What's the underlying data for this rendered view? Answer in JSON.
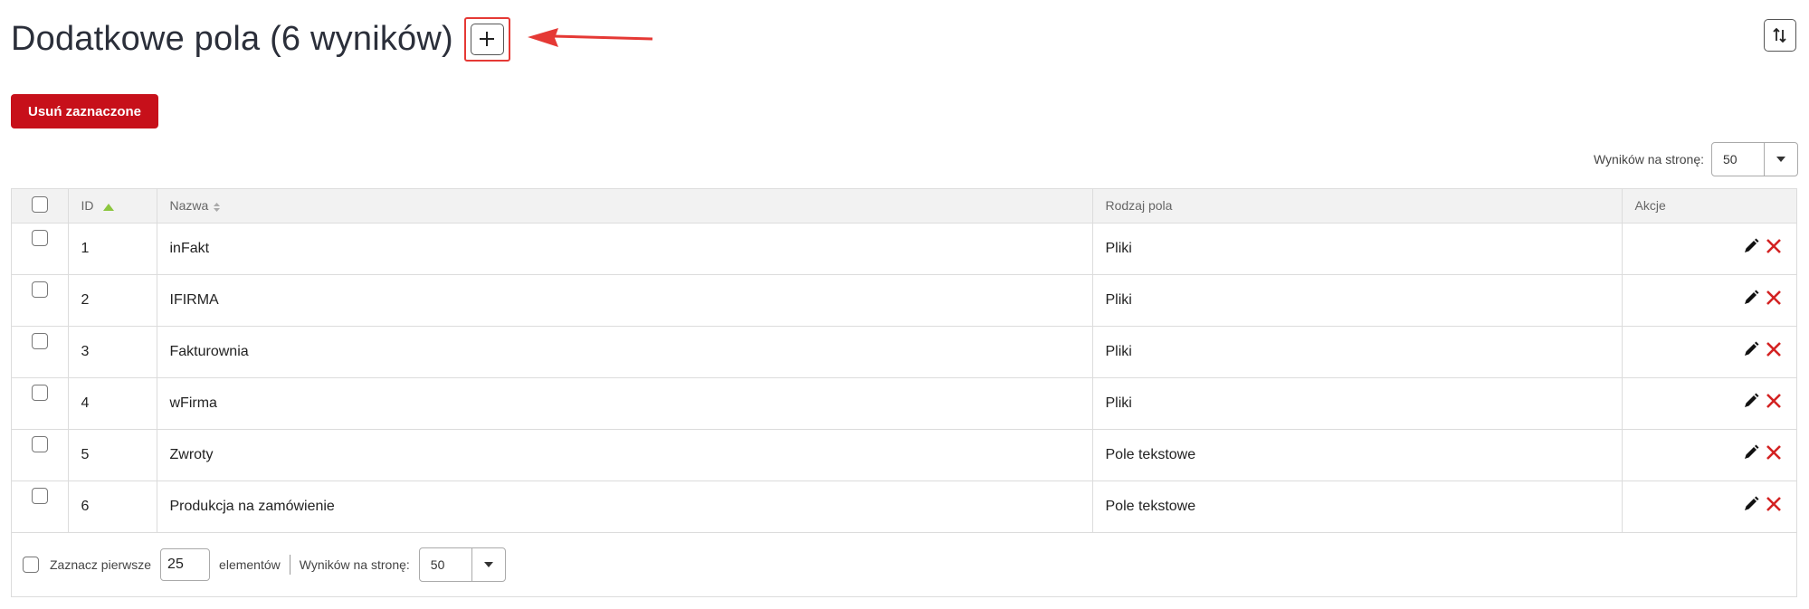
{
  "header": {
    "title": "Dodatkowe pola (6 wyników)",
    "add_label": "+"
  },
  "toolbar": {
    "delete_selected_label": "Usuń zaznaczone"
  },
  "pagination_top": {
    "per_page_label": "Wyników na stronę:",
    "per_page_value": "50"
  },
  "table": {
    "columns": [
      "ID",
      "Nazwa",
      "Rodzaj pola",
      "Akcje"
    ],
    "sorted_column": "ID",
    "rows": [
      {
        "id": "1",
        "name": "inFakt",
        "type": "Pliki"
      },
      {
        "id": "2",
        "name": "IFIRMA",
        "type": "Pliki"
      },
      {
        "id": "3",
        "name": "Fakturownia",
        "type": "Pliki"
      },
      {
        "id": "4",
        "name": "wFirma",
        "type": "Pliki"
      },
      {
        "id": "5",
        "name": "Zwroty",
        "type": "Pole tekstowe"
      },
      {
        "id": "6",
        "name": "Produkcja na zamówienie",
        "type": "Pole tekstowe"
      }
    ]
  },
  "footer": {
    "select_first_label": "Zaznacz pierwsze",
    "select_first_value": "25",
    "elements_label": "elementów",
    "per_page_label": "Wyników na stronę:",
    "per_page_value": "50"
  },
  "colors": {
    "primary_danger": "#c7101a",
    "sort_active": "#8cc63f",
    "annotation": "#e53935"
  },
  "icons": [
    "plus-icon",
    "arrow-left-icon",
    "sort-toggle-icon",
    "caret-down-icon",
    "sort-asc-icon",
    "sort-both-icon",
    "pencil-icon",
    "close-icon"
  ]
}
